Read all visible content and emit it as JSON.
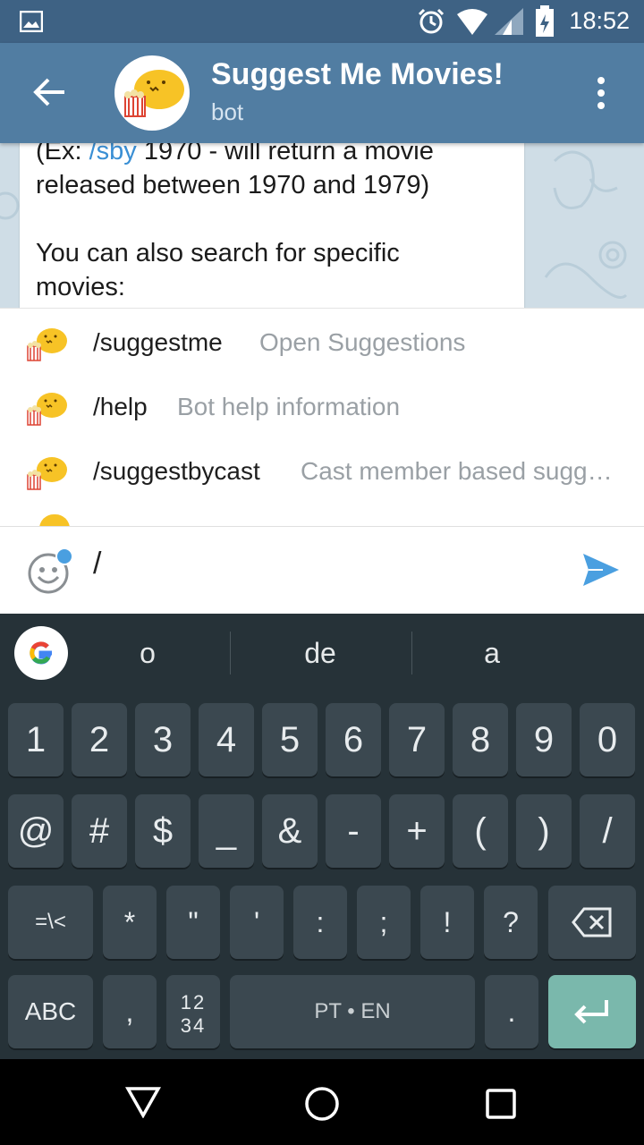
{
  "status_bar": {
    "time": "18:52"
  },
  "header": {
    "title": "Suggest Me Movies!",
    "subtitle": "bot"
  },
  "message": {
    "line1_prefix": "(Ex: ",
    "line1_link": "/sby",
    "line1_suffix": " 1970 - will return a movie",
    "line2": "released between 1970 and 1979)",
    "line3": "You can also search for specific",
    "line4": "movies:"
  },
  "suggestions": [
    {
      "command": "/suggestme",
      "description": "Open Suggestions"
    },
    {
      "command": "/help",
      "description": "Bot help information"
    },
    {
      "command": "/suggestbycast",
      "description": "Cast member based sugg…"
    }
  ],
  "input": {
    "value": "/"
  },
  "keyboard": {
    "suggestion_words": [
      "o",
      "de",
      "a"
    ],
    "row1": [
      "1",
      "2",
      "3",
      "4",
      "5",
      "6",
      "7",
      "8",
      "9",
      "0"
    ],
    "row2": [
      "@",
      "#",
      "$",
      "_",
      "&",
      "-",
      "+",
      "(",
      ")",
      "/"
    ],
    "row3": [
      "=\\<",
      "*",
      "\"",
      "'",
      ":",
      ";",
      "!",
      "?"
    ],
    "abc": "ABC",
    "comma": ",",
    "numpad_top": "12",
    "numpad_bottom": "34",
    "space": "PT • EN",
    "period": "."
  },
  "colors": {
    "header": "#517da2",
    "status_bar": "#3e6284",
    "link": "#3a8fd4",
    "send": "#4a9fe0",
    "enter_key": "#7ab8ac"
  }
}
